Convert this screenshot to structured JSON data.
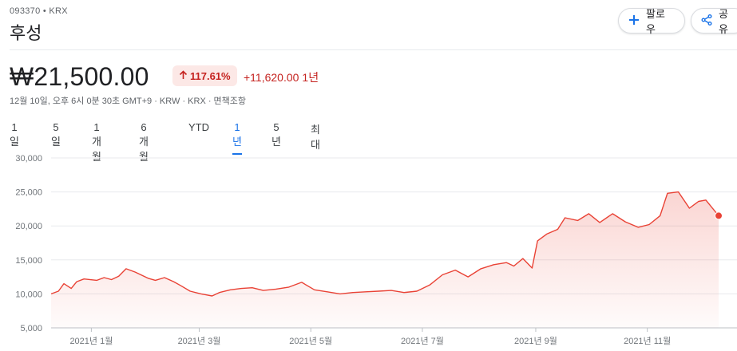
{
  "header": {
    "ticker": "093370 • KRX",
    "company": "후성",
    "follow_label": "팔로우",
    "share_label": "공유"
  },
  "quote": {
    "price": "₩21,500.00",
    "change_percent": "117.61%",
    "change_value": "+11,620.00",
    "change_period": "1년",
    "meta": "12월 10일, 오후 6시 0분 30초 GMT+9 · KRW · KRX · 면책조항"
  },
  "tabs": [
    {
      "label": "1일"
    },
    {
      "label": "5일"
    },
    {
      "label": "1개월"
    },
    {
      "label": "6개월"
    },
    {
      "label": "YTD"
    },
    {
      "label": "1년",
      "active": true
    },
    {
      "label": "5년"
    },
    {
      "label": "최대"
    }
  ],
  "colors": {
    "line": "#e94235",
    "fill": "#fce8e6",
    "positive": "#c5221f",
    "accent": "#1a73e8"
  },
  "icons": {
    "follow": "plus-icon",
    "share": "share-icon",
    "change": "arrow-up-icon"
  },
  "chart_data": {
    "type": "area",
    "title": "",
    "xlabel": "",
    "ylabel": "",
    "ylim": [
      5000,
      30000
    ],
    "yticks": [
      5000,
      10000,
      15000,
      20000,
      25000,
      30000
    ],
    "ytick_labels": [
      "5,000",
      "10,000",
      "15,000",
      "20,000",
      "25,000",
      "30,000"
    ],
    "x_range": [
      "2020-12-10",
      "2021-12-10"
    ],
    "xtick_dates": [
      "2021-01-01",
      "2021-03-01",
      "2021-05-01",
      "2021-07-01",
      "2021-09-01",
      "2021-11-01"
    ],
    "xtick_labels": [
      "2021년 1월",
      "2021년 3월",
      "2021년 5월",
      "2021년 7월",
      "2021년 9월",
      "2021년 11월"
    ],
    "grid": true,
    "series": [
      {
        "x": [
          "2020-12-10",
          "2020-12-14",
          "2020-12-17",
          "2020-12-21",
          "2020-12-24",
          "2020-12-28",
          "2021-01-04",
          "2021-01-08",
          "2021-01-12",
          "2021-01-16",
          "2021-01-20",
          "2021-01-25",
          "2021-02-01",
          "2021-02-05",
          "2021-02-10",
          "2021-02-15",
          "2021-02-19",
          "2021-02-24",
          "2021-03-02",
          "2021-03-08",
          "2021-03-12",
          "2021-03-18",
          "2021-03-24",
          "2021-03-30",
          "2021-04-05",
          "2021-04-12",
          "2021-04-19",
          "2021-04-26",
          "2021-05-03",
          "2021-05-10",
          "2021-05-17",
          "2021-05-24",
          "2021-05-31",
          "2021-06-07",
          "2021-06-14",
          "2021-06-21",
          "2021-06-28",
          "2021-07-05",
          "2021-07-12",
          "2021-07-19",
          "2021-07-26",
          "2021-08-02",
          "2021-08-09",
          "2021-08-16",
          "2021-08-20",
          "2021-08-25",
          "2021-08-30",
          "2021-09-02",
          "2021-09-07",
          "2021-09-13",
          "2021-09-17",
          "2021-09-24",
          "2021-09-30",
          "2021-10-06",
          "2021-10-13",
          "2021-10-20",
          "2021-10-27",
          "2021-11-02",
          "2021-11-08",
          "2021-11-12",
          "2021-11-18",
          "2021-11-24",
          "2021-11-29",
          "2021-12-03",
          "2021-12-10"
        ],
        "values": [
          10000,
          10400,
          11500,
          10800,
          11800,
          12200,
          12000,
          12400,
          12100,
          12600,
          13700,
          13200,
          12300,
          12000,
          12400,
          11800,
          11200,
          10400,
          10000,
          9700,
          10200,
          10600,
          10800,
          10900,
          10500,
          10700,
          11000,
          11700,
          10600,
          10300,
          10000,
          10200,
          10300,
          10400,
          10500,
          10200,
          10400,
          11300,
          12800,
          13500,
          12500,
          13700,
          14300,
          14600,
          14100,
          15200,
          13800,
          17800,
          18800,
          19500,
          21200,
          20800,
          21800,
          20500,
          21800,
          20600,
          19800,
          20200,
          21500,
          24800,
          25000,
          22600,
          23600,
          23800,
          21500
        ]
      }
    ]
  }
}
